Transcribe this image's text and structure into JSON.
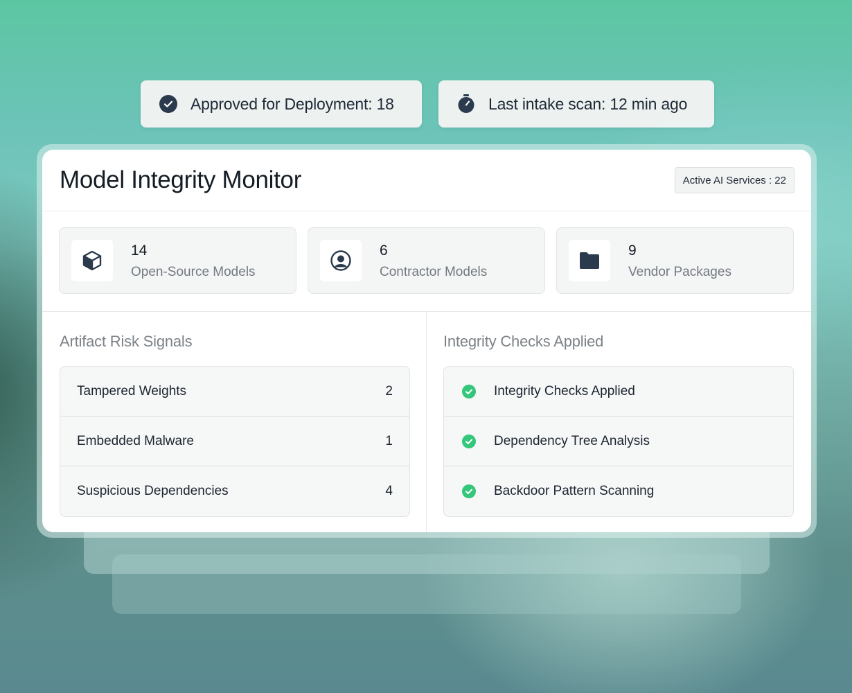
{
  "pills": {
    "approved": {
      "text": "Approved for Deployment: 18",
      "icon": "check-circle-icon"
    },
    "scan": {
      "text": "Last intake scan: 12 min ago",
      "icon": "stopwatch-icon"
    }
  },
  "card": {
    "title": "Model Integrity Monitor",
    "badge": "Active AI Services : 22"
  },
  "stats": [
    {
      "value": "14",
      "label": "Open-Source Models",
      "icon": "cube-icon"
    },
    {
      "value": "6",
      "label": "Contractor Models",
      "icon": "user-circle-icon"
    },
    {
      "value": "9",
      "label": "Vendor Packages",
      "icon": "folder-icon"
    }
  ],
  "risk": {
    "title": "Artifact Risk Signals",
    "rows": [
      {
        "label": "Tampered Weights",
        "value": "2"
      },
      {
        "label": "Embedded Malware",
        "value": "1"
      },
      {
        "label": "Suspicious Dependencies",
        "value": "4"
      }
    ]
  },
  "checks": {
    "title": "Integrity Checks Applied",
    "rows": [
      {
        "label": "Integrity Checks Applied",
        "icon": "green-check-icon"
      },
      {
        "label": "Dependency Tree Analysis",
        "icon": "green-check-icon"
      },
      {
        "label": "Backdoor Pattern Scanning",
        "icon": "green-check-icon"
      }
    ]
  },
  "colors": {
    "accent_green": "#34c77b",
    "icon_dark": "#2b3a4c"
  }
}
